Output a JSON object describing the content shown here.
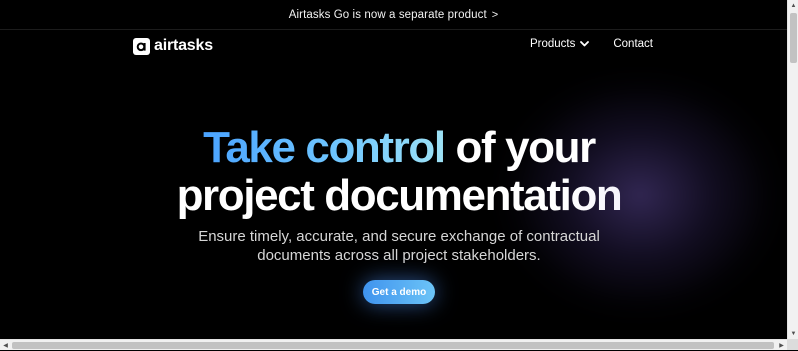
{
  "announcement": {
    "text": "Airtasks Go is now a separate product",
    "chevron": ">"
  },
  "header": {
    "logo_text": "airtasks",
    "logo_icon": "airtasks-logo-icon",
    "nav": {
      "products_label": "Products",
      "contact_label": "Contact"
    }
  },
  "hero": {
    "title_highlight": "Take control",
    "title_rest": " of your",
    "title_line2": "project documentation",
    "subtitle_line1": "Ensure timely, accurate, and secure exchange of contractual",
    "subtitle_line2": "documents across all project stakeholders.",
    "cta_label": "Get a demo"
  },
  "colors": {
    "background": "#000000",
    "accent_start": "#4aa3ff",
    "accent_end": "#9ee2f5",
    "glow": "#5a4696"
  },
  "scrollbars": {
    "up_arrow": "▲",
    "down_arrow": "▼",
    "left_arrow": "◀",
    "right_arrow": "▶"
  }
}
